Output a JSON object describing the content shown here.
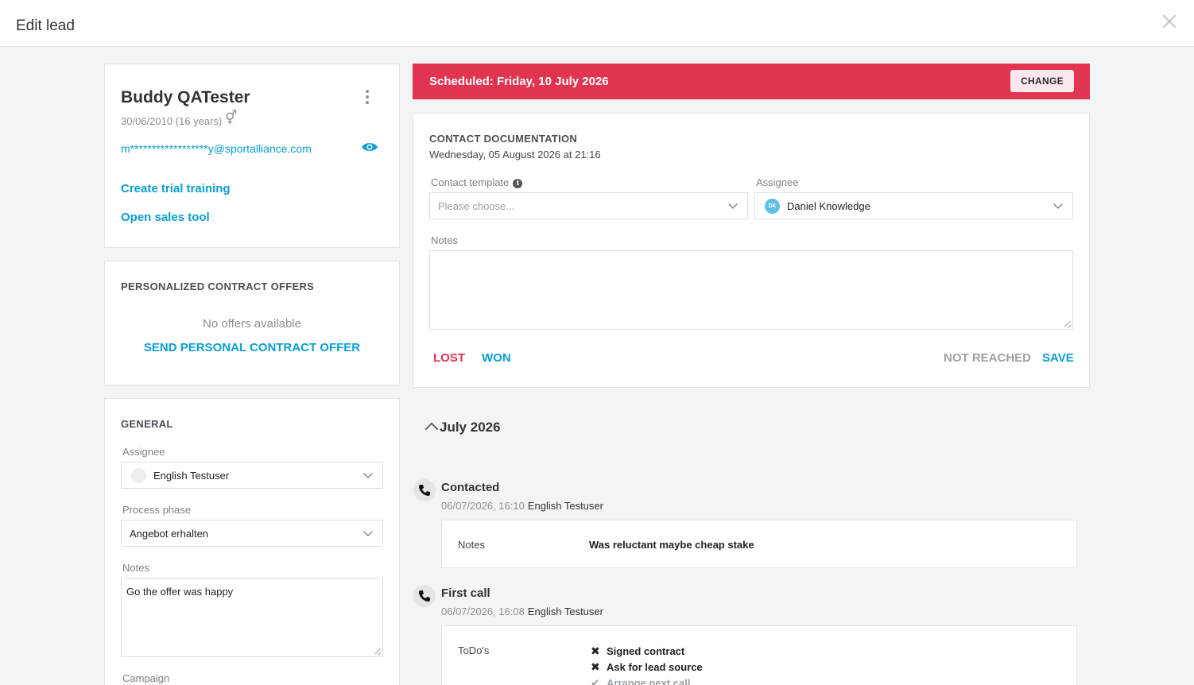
{
  "header": {
    "title": "Edit lead"
  },
  "profile": {
    "name": "Buddy QATester",
    "dob": "30/06/2010 (16 years)",
    "email": "m******************y@sportalliance.com",
    "create_trial": "Create trial training",
    "open_sales": "Open sales tool"
  },
  "offers": {
    "title": "PERSONALIZED CONTRACT OFFERS",
    "none": "No offers available",
    "send": "SEND PERSONAL CONTRACT OFFER"
  },
  "general": {
    "title": "GENERAL",
    "assignee_label": "Assignee",
    "assignee_value": "English Testuser",
    "phase_label": "Process phase",
    "phase_value": "Angebot erhalten",
    "notes_label": "Notes",
    "notes_value": "Go the offer was happy",
    "campaign_label": "Campaign"
  },
  "banner": {
    "text": "Scheduled: Friday, 10 July 2026",
    "change": "CHANGE"
  },
  "contact_doc": {
    "title": "CONTACT DOCUMENTATION",
    "date": "Wednesday, 05 August 2026 at 21:16",
    "template_label": "Contact template",
    "template_placeholder": "Please choose...",
    "assignee_label": "Assignee",
    "assignee_initials": "DK",
    "assignee_value": "Daniel Knowledge",
    "notes_label": "Notes",
    "lost": "LOST",
    "won": "WON",
    "not_reached": "NOT REACHED",
    "save": "SAVE"
  },
  "timeline": {
    "month": "July 2026",
    "entries": [
      {
        "title": "Contacted",
        "time": "06/07/2026, 16:10",
        "user": "English Testuser",
        "note_key": "Notes",
        "note_value": "Was reluctant maybe cheap stake"
      },
      {
        "title": "First call",
        "time": "06/07/2026, 16:08",
        "user": "English Testuser",
        "todo_key": "ToDo's",
        "todos": [
          {
            "label": "Signed contract",
            "done": false
          },
          {
            "label": "Ask for lead source",
            "done": false
          },
          {
            "label": "Arrange next call",
            "done": true
          }
        ]
      }
    ]
  },
  "colors": {
    "accent": "#0a9ed2",
    "danger": "#e03450",
    "muted": "#8a9096"
  }
}
